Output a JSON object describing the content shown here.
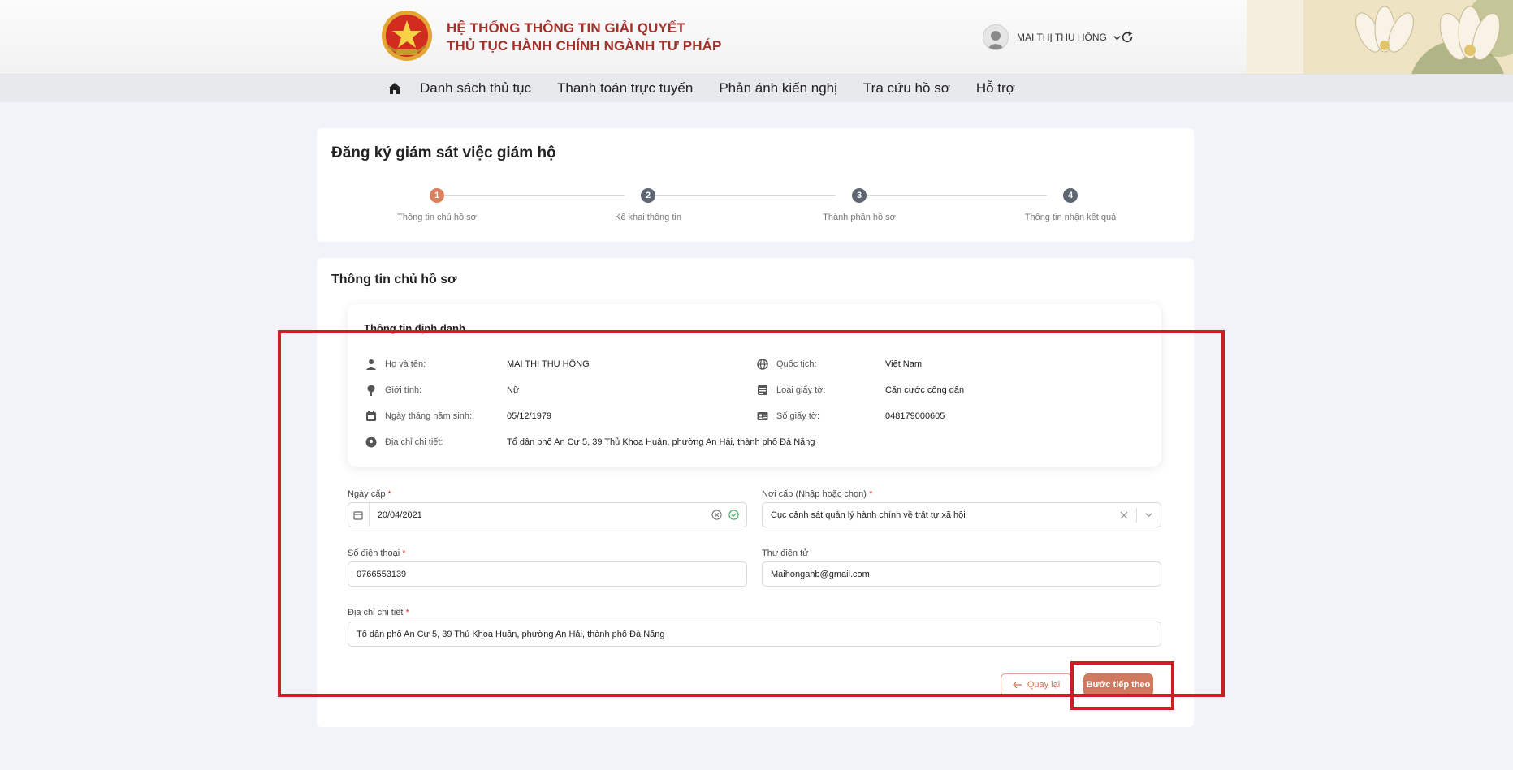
{
  "header": {
    "title_line1": "HỆ THỐNG THÔNG TIN GIẢI QUYẾT",
    "title_line2": "THỦ TỤC HÀNH CHÍNH NGÀNH TƯ PHÁP",
    "user_name": "MAI THỊ THU HỒNG",
    "icons": [
      "emblem-logo",
      "avatar",
      "chevron-down-icon",
      "refresh-icon"
    ]
  },
  "nav": {
    "home_icon": "home-icon",
    "items": [
      "Danh sách thủ tục",
      "Thanh toán trực tuyến",
      "Phản ánh kiến nghị",
      "Tra cứu hồ sơ",
      "Hỗ trợ"
    ]
  },
  "page": {
    "title": "Đăng ký giám sát việc giám hộ",
    "steps": [
      {
        "number": "1",
        "label": "Thông tin chủ hồ sơ",
        "active": true
      },
      {
        "number": "2",
        "label": "Kê khai thông tin",
        "active": false
      },
      {
        "number": "3",
        "label": "Thành phần hồ sơ",
        "active": false
      },
      {
        "number": "4",
        "label": "Thông tin nhận kết quả",
        "active": false
      }
    ],
    "colors": {
      "active_step": "#d9805f",
      "inactive_step": "#5e6673",
      "accent": "#cf7a5e",
      "highlight": "#c82027"
    }
  },
  "owner": {
    "section_title": "Thông tin chủ hồ sơ",
    "id_card_title": "Thông tin định danh",
    "info": [
      {
        "icon": "person-icon",
        "label": "Họ và tên:",
        "value": "MAI THỊ THU HỒNG"
      },
      {
        "icon": "gender-icon",
        "label": "Giới tính:",
        "value": "Nữ"
      },
      {
        "icon": "calendar-icon",
        "label": "Ngày tháng năm sinh:",
        "value": "05/12/1979"
      },
      {
        "icon": "location-icon",
        "label": "Địa chỉ chi tiết:",
        "value": "Tổ dân phố An Cư 5, 39 Thủ Khoa Huân, phường An Hải, thành phố Đà Nẵng"
      },
      {
        "icon": "globe-icon",
        "label": "Quốc tịch:",
        "value": "Việt Nam"
      },
      {
        "icon": "document-icon",
        "label": "Loại giấy tờ:",
        "value": "Căn cước công dân"
      },
      {
        "icon": "id-card-icon",
        "label": "Số giấy tờ:",
        "value": "048179000605"
      }
    ]
  },
  "form": {
    "issue_date": {
      "label": "Ngày cấp",
      "value": "20/04/2021"
    },
    "issue_place": {
      "label": "Nơi cấp (Nhập hoặc chọn)",
      "value": "Cục cảnh sát quản lý hành chính về trật tự xã hội"
    },
    "phone": {
      "label": "Số điện thoại",
      "value": "0766553139"
    },
    "email": {
      "label": "Thư điện tử",
      "value": "Maihongahb@gmail.com"
    },
    "address": {
      "label": "Địa chỉ chi tiết",
      "value": "Tổ dân phố An Cư 5, 39 Thủ Khoa Huân, phường An Hải, thành phố Đà Nẵng"
    },
    "required_mark": "*"
  },
  "buttons": {
    "back": "Quay lại",
    "next": "Bước tiếp theo"
  }
}
